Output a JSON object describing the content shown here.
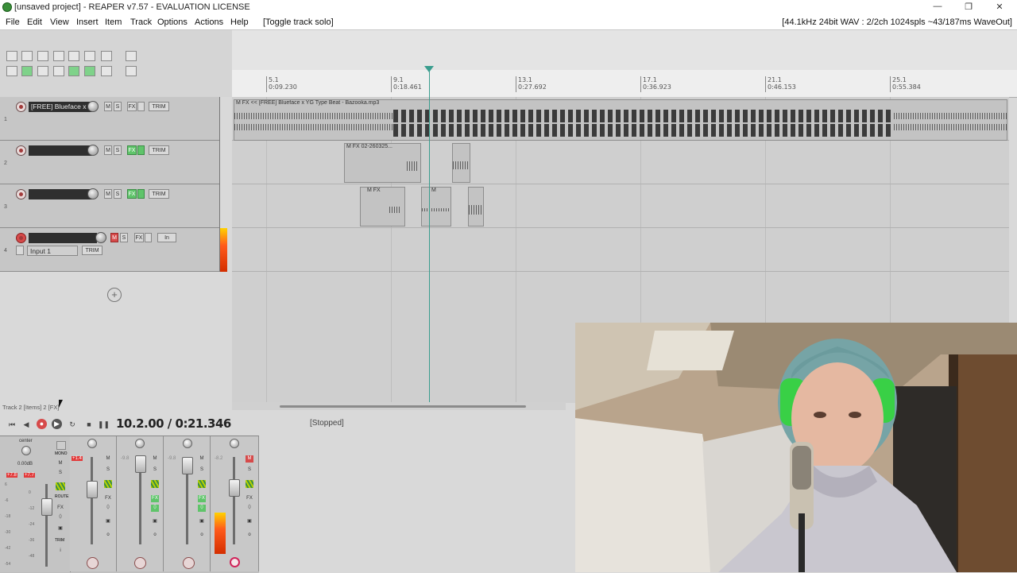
{
  "window": {
    "title": "[unsaved project] - REAPER v7.57 - EVALUATION LICENSE",
    "minimize": "—",
    "maximize": "❐",
    "close": "✕"
  },
  "menu": {
    "items": [
      "File",
      "Edit",
      "View",
      "Insert",
      "Item",
      "Track",
      "Options",
      "Actions",
      "Help",
      "[Toggle track solo]"
    ],
    "audio_status": "[44.1kHz 24bit WAV : 2/2ch 1024spls ~43/187ms WaveOut]"
  },
  "ruler": {
    "marks": [
      {
        "bar": "5.1",
        "time": "0:09.230"
      },
      {
        "bar": "9.1",
        "time": "0:18.461"
      },
      {
        "bar": "13.1",
        "time": "0:27.692"
      },
      {
        "bar": "17.1",
        "time": "0:36.923"
      },
      {
        "bar": "21.1",
        "time": "0:46.153"
      },
      {
        "bar": "25.1",
        "time": "0:55.384"
      }
    ]
  },
  "tracks": [
    {
      "number": "1",
      "name": "[FREE] Blueface x",
      "armed": false
    },
    {
      "number": "2",
      "name": "",
      "armed": false
    },
    {
      "number": "3",
      "name": "",
      "armed": false
    },
    {
      "number": "4",
      "name": "",
      "armed": true,
      "input": "Input 1"
    }
  ],
  "track_buttons": {
    "mute": "M",
    "solo": "S",
    "fx": "FX",
    "trim": "TRIM",
    "in": "In"
  },
  "items": {
    "track1": "M FX << [FREE] Blueface x YG Type Beat - Bazooka.mp3",
    "track2": "M FX 02-260325...",
    "track3a": "M FX",
    "track3b": "M"
  },
  "transport": {
    "time": "10.2.00 / 0:21.346",
    "state": "[Stopped]",
    "status_line": "Track 2 [Items] 2 [FX]"
  },
  "mixer": {
    "master": {
      "pan": "center",
      "peak_left": "+7.8",
      "peak_right": "+7.7",
      "db": "0.00dB",
      "mono": "MONO",
      "route": "ROUTE",
      "trim": "TRIM"
    },
    "scale": [
      "6",
      "0",
      "-6",
      "-12",
      "-18",
      "-24",
      "-30",
      "-36",
      "-42",
      "-48",
      "-54"
    ],
    "channels": [
      {
        "value": "+1.4",
        "peak_color": "#e23a3a"
      },
      {
        "value": "-9.8",
        "peak_color": "#c9c9c9"
      },
      {
        "value": "-9.8",
        "peak_color": "#c9c9c9"
      },
      {
        "value": "-8.2",
        "peak_color": "#c9c9c9"
      }
    ]
  },
  "colors": {
    "accent": "#3a9d8e",
    "rec": "#d64a4a",
    "fx_on": "#5fc46a"
  }
}
